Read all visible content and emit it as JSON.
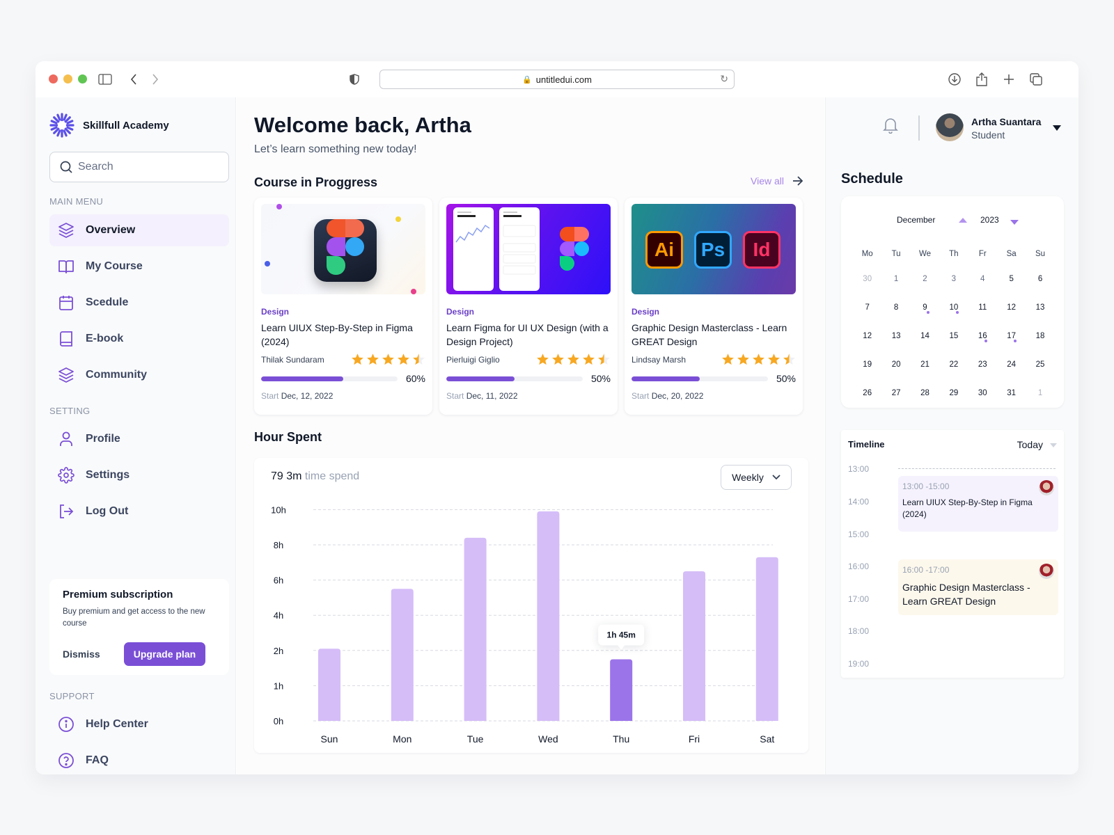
{
  "browser": {
    "url": "untitledui.com",
    "traffic_lights": [
      "#ee6a5e",
      "#f5bf4f",
      "#61c554"
    ]
  },
  "sidebar": {
    "brand": "Skillfull Academy",
    "search_placeholder": "Search",
    "main_menu_label": "MAIN MENU",
    "main_menu": [
      {
        "label": "Overview",
        "icon": "layers-icon",
        "active": true
      },
      {
        "label": "My Course",
        "icon": "book-open-icon"
      },
      {
        "label": "Scedule",
        "icon": "calendar-icon"
      },
      {
        "label": "E-book",
        "icon": "book-icon"
      },
      {
        "label": "Community",
        "icon": "layers-icon"
      }
    ],
    "setting_label": "SETTING",
    "setting_menu": [
      {
        "label": "Profile",
        "icon": "user-icon"
      },
      {
        "label": "Settings",
        "icon": "gear-icon"
      },
      {
        "label": "Log Out",
        "icon": "logout-icon"
      }
    ],
    "premium": {
      "title": "Premium subscription",
      "text": "Buy premium and get access to the new course",
      "dismiss": "Dismiss",
      "upgrade": "Upgrade plan"
    },
    "support_label": "SUPPORT",
    "support_menu": [
      {
        "label": "Help Center",
        "icon": "info-icon"
      },
      {
        "label": "FAQ",
        "icon": "help-circle-icon"
      }
    ]
  },
  "main": {
    "title": "Welcome back, Artha",
    "subtitle": "Let’s learn something new today!",
    "courses_heading": "Course in Proggress",
    "view_all": "View all",
    "courses": [
      {
        "category": "Design",
        "title": "Learn UIUX Step-By-Step in Figma (2024)",
        "author": "Thilak Sundaram",
        "rating": 4.5,
        "progress": 60,
        "progress_label": "60%",
        "start_label": "Start",
        "start_date": "Dec, 12, 2022"
      },
      {
        "category": "Design",
        "title": "Learn Figma for UI UX Design (with a Design Project)",
        "author": "Pierluigi Giglio",
        "rating": 4.5,
        "progress": 50,
        "progress_label": "50%",
        "start_label": "Start",
        "start_date": "Dec, 11, 2022"
      },
      {
        "category": "Design",
        "title": "Graphic Design Masterclass - Learn GREAT Design",
        "author": "Lindsay Marsh",
        "rating": 4.5,
        "progress": 50,
        "progress_label": "50%",
        "start_label": "Start",
        "start_date": "Dec, 20, 2022"
      }
    ],
    "hours_heading": "Hour Spent",
    "total_value": "79 3m",
    "total_suffix": "time spend",
    "period": "Weekly"
  },
  "chart_data": {
    "type": "bar",
    "title": "Hour Spent",
    "categories": [
      "Sun",
      "Mon",
      "Tue",
      "Wed",
      "Thu",
      "Fri",
      "Sat"
    ],
    "values": [
      2.1,
      5.5,
      8.4,
      9.9,
      1.75,
      6.5,
      7.3
    ],
    "unit": "hours",
    "y_ticks": [
      0,
      1,
      2,
      4,
      6,
      8,
      10
    ],
    "y_tick_labels": [
      "0h",
      "1h",
      "2h",
      "4h",
      "6h",
      "8h",
      "10h"
    ],
    "ylim": [
      0,
      10
    ],
    "grid": true,
    "highlighted": "Thu",
    "tooltip": "1h 45m",
    "colors": {
      "bar": "#d5bdf8",
      "highlight": "#9b74e9"
    }
  },
  "right": {
    "user_name": "Artha Suantara",
    "user_role": "Student",
    "schedule_heading": "Schedule",
    "calendar": {
      "month": "December",
      "year": "2023",
      "weekdays": [
        "Mo",
        "Tu",
        "We",
        "Th",
        "Fr",
        "Sa",
        "Su"
      ],
      "weeks": [
        [
          {
            "d": "30",
            "s": "muted"
          },
          {
            "d": "1",
            "s": "mid"
          },
          {
            "d": "2",
            "s": "mid"
          },
          {
            "d": "3",
            "s": "mid"
          },
          {
            "d": "4",
            "s": "mid"
          },
          {
            "d": "5"
          },
          {
            "d": "6"
          }
        ],
        [
          {
            "d": "7"
          },
          {
            "d": "8"
          },
          {
            "d": "9",
            "ev": true
          },
          {
            "d": "10",
            "ev": true
          },
          {
            "d": "11"
          },
          {
            "d": "12"
          },
          {
            "d": "13"
          }
        ],
        [
          {
            "d": "12"
          },
          {
            "d": "13"
          },
          {
            "d": "14"
          },
          {
            "d": "15"
          },
          {
            "d": "16",
            "ev": true
          },
          {
            "d": "17",
            "ev": true
          },
          {
            "d": "18"
          }
        ],
        [
          {
            "d": "19"
          },
          {
            "d": "20"
          },
          {
            "d": "21"
          },
          {
            "d": "22"
          },
          {
            "d": "23"
          },
          {
            "d": "24"
          },
          {
            "d": "25"
          }
        ],
        [
          {
            "d": "26"
          },
          {
            "d": "27"
          },
          {
            "d": "28"
          },
          {
            "d": "29"
          },
          {
            "d": "30"
          },
          {
            "d": "31"
          },
          {
            "d": "1",
            "s": "muted"
          }
        ]
      ]
    },
    "timeline": {
      "title": "Timeline",
      "filter": "Today",
      "hours": [
        "13:00",
        "14:00",
        "15:00",
        "16:00",
        "17:00",
        "18:00",
        "19:00"
      ],
      "events": [
        {
          "time": "13:00 -15:00",
          "title": "Learn UIUX Step-By-Step in Figma (2024)",
          "color": "#f5f2fd"
        },
        {
          "time": "16:00 -17:00",
          "title": "Graphic Design Masterclass - Learn GREAT Design",
          "color": "#fdf8ec"
        }
      ]
    }
  }
}
